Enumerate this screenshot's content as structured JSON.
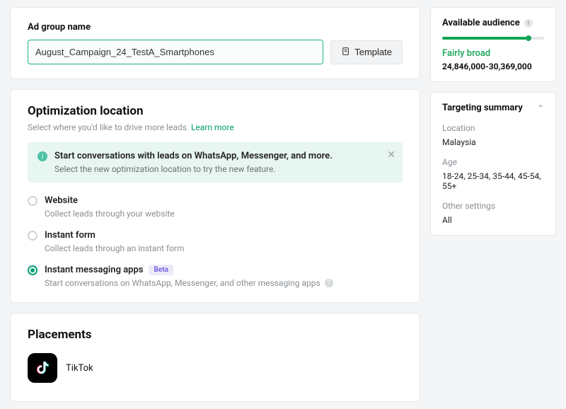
{
  "ad_group": {
    "label": "Ad group name",
    "value": "August_Campaign_24_TestA_Smartphones",
    "template_btn": "Template"
  },
  "optimization": {
    "title": "Optimization location",
    "subtitle": "Select where you'd like to drive more leads.",
    "learn_more": "Learn more",
    "notice": {
      "title": "Start conversations with leads on WhatsApp, Messenger, and more.",
      "subtitle": "Select the new optimization location to try the new feature."
    },
    "options": [
      {
        "title": "Website",
        "subtitle": "Collect leads through your website",
        "checked": false
      },
      {
        "title": "Instant form",
        "subtitle": "Collect leads through an instant form",
        "checked": false
      },
      {
        "title": "Instant messaging apps",
        "subtitle": "Start conversations on WhatsApp, Messenger, and other messaging apps",
        "checked": true,
        "badge": "Beta"
      }
    ]
  },
  "placements": {
    "title": "Placements",
    "items": [
      {
        "name": "TikTok"
      }
    ]
  },
  "audience": {
    "title": "Available audience",
    "status": "Fairly broad",
    "count": "24,846,000-30,369,000"
  },
  "targeting": {
    "title": "Targeting summary",
    "rows": [
      {
        "label": "Location",
        "value": "Malaysia"
      },
      {
        "label": "Age",
        "value": "18-24, 25-34, 35-44, 45-54, 55+"
      },
      {
        "label": "Other settings",
        "value": "All"
      }
    ]
  }
}
